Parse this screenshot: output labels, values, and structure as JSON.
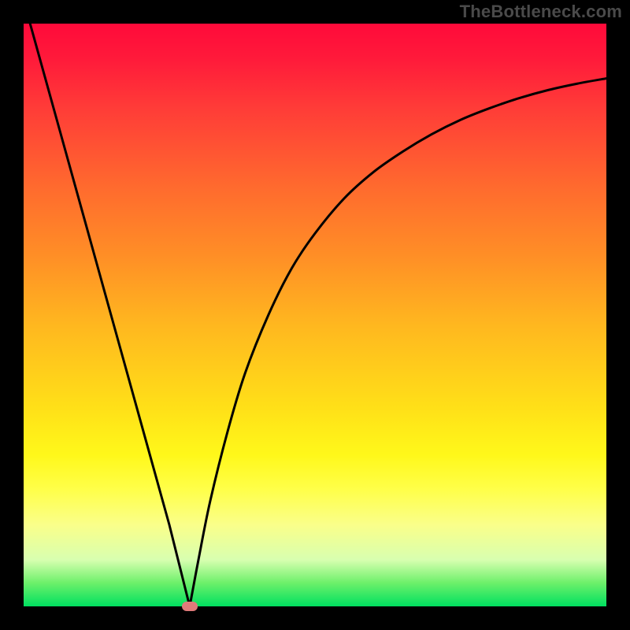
{
  "watermark": "TheBottleneck.com",
  "chart_data": {
    "type": "line",
    "title": "",
    "xlabel": "",
    "ylabel": "",
    "xlim": [
      0,
      100
    ],
    "ylim": [
      0,
      100
    ],
    "background_gradient": {
      "top_color": "#ff0a3a",
      "bottom_color": "#00e060",
      "meaning": "red-high to green-low bottleneck scale"
    },
    "series": [
      {
        "name": "left-branch",
        "x": [
          0,
          5,
          10,
          15,
          20,
          25,
          28.5
        ],
        "values": [
          104,
          86,
          68,
          50,
          32,
          14,
          0
        ]
      },
      {
        "name": "right-branch",
        "x": [
          28.5,
          30,
          32,
          35,
          38,
          42,
          46,
          50,
          55,
          60,
          65,
          70,
          75,
          80,
          85,
          90,
          95,
          100
        ],
        "values": [
          0,
          8,
          18,
          30,
          40,
          50,
          58,
          64,
          70,
          74.5,
          78,
          81,
          83.5,
          85.5,
          87.2,
          88.6,
          89.7,
          90.6
        ]
      }
    ],
    "minimum_point": {
      "x": 28.5,
      "y": 0
    },
    "marker": {
      "x": 28.5,
      "y": 0,
      "color": "#e07a7a"
    },
    "grid": false,
    "legend": false
  },
  "colors": {
    "frame": "#000000",
    "watermark": "#4a4a4a",
    "curve": "#000000",
    "marker": "#e07a7a"
  }
}
